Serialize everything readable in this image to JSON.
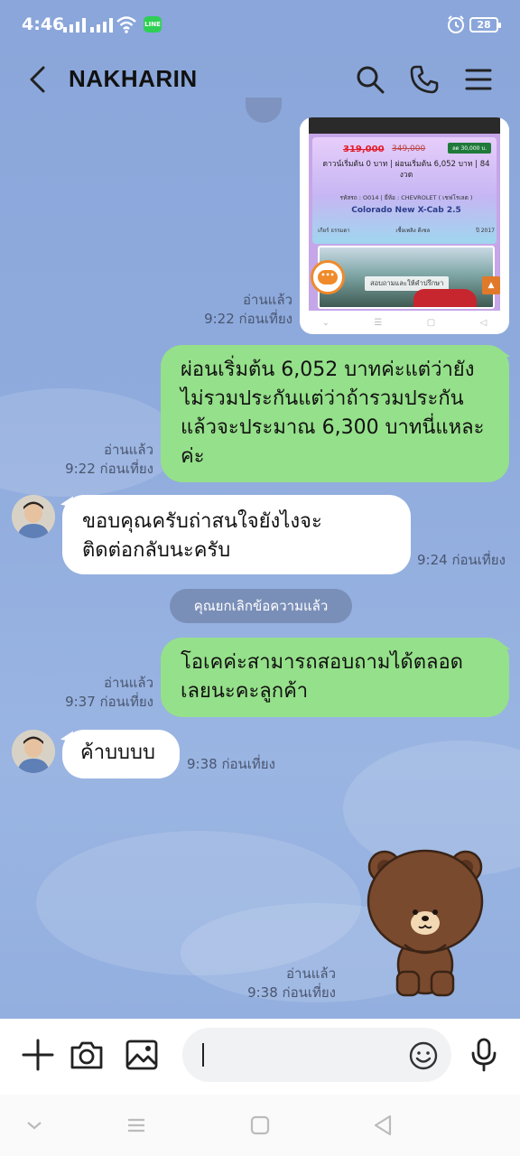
{
  "status_bar": {
    "time": "4:46",
    "line_badge": "LINE",
    "battery": "28"
  },
  "header": {
    "contact_name": "NAKHARIN"
  },
  "image_message": {
    "price_new": "319,000",
    "price_old": "349,000",
    "tag": "ลด 30,000 บ.",
    "down_payment_line": "ดาวน์เริ่มต้น 0 บาท | ผ่อนเริ่มต้น 6,052 บาท | 84 งวด",
    "info_line": "รหัสรถ : O014 | ยี่ห้อ : CHEVROLET ( เชฟโรเลต )",
    "model": "Colorado New X-Cab 2.5",
    "footer": [
      "เกียร์ ธรรมดา",
      "เชื้อเพลิง ดีเซล",
      "ปี 2017"
    ],
    "photo_caption": "สอบถามและให้คำปรึกษา",
    "read_status": "อ่านแล้ว",
    "time": "9:22 ก่อนเที่ยง"
  },
  "messages": [
    {
      "text": "ผ่อนเริ่มต้น 6,052 บาทค่ะแต่ว่ายัง\nไม่รวมประกันแต่ว่าถ้ารวมประกัน\nแล้วจะประมาณ 6,300 บาทนี่แหละ\nค่ะ",
      "read_status": "อ่านแล้ว",
      "time": "9:22 ก่อนเที่ยง"
    },
    {
      "text": " ขอบคุณครับถ่าสนใจยังไงจะ\nติดต่อกลับนะครับ",
      "time": "9:24 ก่อนเที่ยง"
    },
    {
      "text": "โอเคค่ะสามารถสอบถามได้ตลอด\nเลยนะคะลูกค้า",
      "read_status": "อ่านแล้ว",
      "time": "9:37 ก่อนเที่ยง"
    },
    {
      "text": "ค้าบบบบ",
      "time": "9:38 ก่อนเที่ยง"
    }
  ],
  "system_notice": "คุณยกเลิกข้อความแล้ว",
  "sticker_message": {
    "read_status": "อ่านแล้ว",
    "time": "9:38 ก่อนเที่ยง"
  },
  "colors": {
    "chat_background": "#8fa9d9",
    "outgoing_bubble": "#95e08a",
    "incoming_bubble": "#ffffff"
  }
}
